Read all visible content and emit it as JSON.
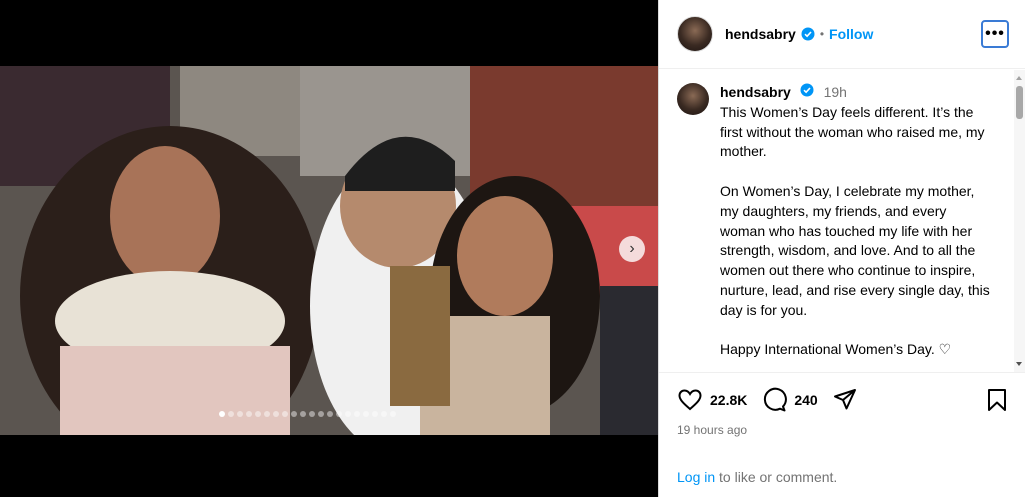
{
  "header": {
    "username": "hendsabry",
    "bullet": "•",
    "follow_label": "Follow",
    "more_label": "•••"
  },
  "caption": {
    "username": "hendsabry",
    "time": "19h",
    "text": "This Women’s Day feels different. It’s the first without the woman who raised me, my mother.\n\nOn Women’s Day, I celebrate my mother, my daughters, my friends, and every woman who has touched my life with her strength, wisdom, and love. And to all the women out there who continue to inspire, nurture, lead, and rise every single day, this day is for you.\n\nHappy International Women’s Day. ♡"
  },
  "actions": {
    "likes": "22.8K",
    "comments": "240",
    "time_ago": "19 hours ago"
  },
  "login": {
    "link": "Log in",
    "text": " to like or comment."
  },
  "carousel": {
    "slide_count": 20,
    "active_index": 0,
    "next_icon": "chevron-right-icon"
  },
  "icons": {
    "verified": "verified-badge-icon",
    "like": "heart-icon",
    "comment": "comment-bubble-icon",
    "share": "paper-plane-icon",
    "save": "bookmark-icon"
  },
  "colors": {
    "link_blue": "#0095f6",
    "verified_blue": "#0095f6",
    "secondary_text": "#737373"
  }
}
